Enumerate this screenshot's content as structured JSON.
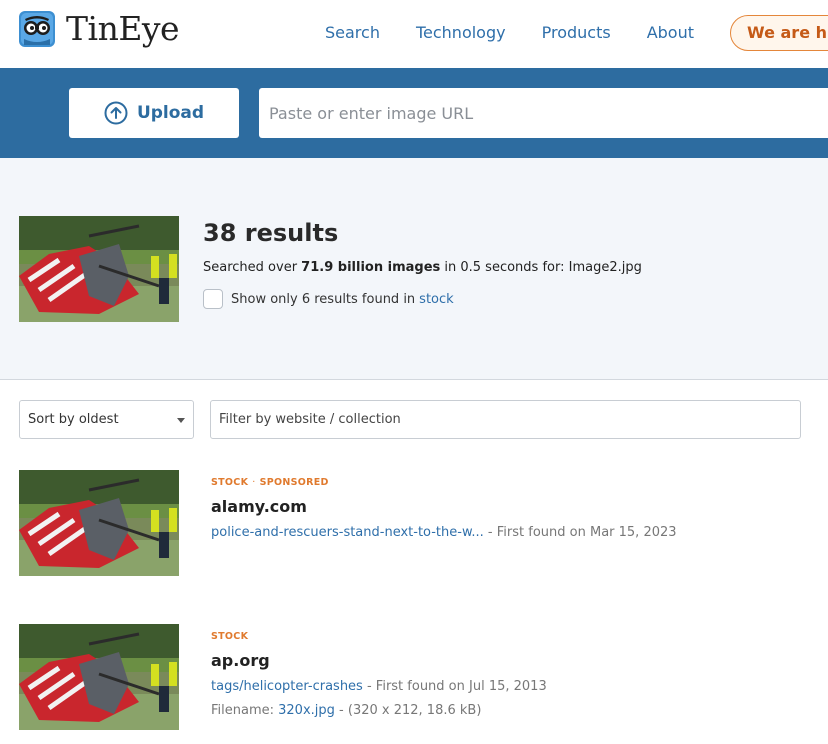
{
  "header": {
    "brand": "TinEye",
    "nav": [
      "Search",
      "Technology",
      "Products",
      "About"
    ],
    "hire_label": "We are hiring"
  },
  "search": {
    "upload_label": "Upload",
    "url_placeholder": "Paste or enter image URL"
  },
  "summary": {
    "count": "38 results",
    "searched_prefix": "Searched over ",
    "images_count": "71.9 billion images",
    "searched_mid": " in 0.5 seconds for: ",
    "filename": "Image2.jpg",
    "stock_text": "Show only 6 results found in ",
    "stock_link": "stock"
  },
  "filters": {
    "sort_value": "Sort by oldest",
    "filter_placeholder": "Filter by website / collection"
  },
  "results": [
    {
      "tag1": "STOCK",
      "tag_sep": "·",
      "tag2": "SPONSORED",
      "domain": "alamy.com",
      "link": "police-and-rescuers-stand-next-to-the-w...",
      "found": "First found on Mar 15, 2023"
    },
    {
      "tag1": "STOCK",
      "domain": "ap.org",
      "link": "tags/helicopter-crashes",
      "found": "First found on Jul 15, 2013",
      "filename_label": "Filename: ",
      "filename": "320x.jpg",
      "file_info": "(320 x 212, 18.6 kB)"
    }
  ],
  "colors": {
    "accent": "#2d6ca0",
    "link": "#2f6faa",
    "tag": "#e07a2e",
    "hire_border": "#e4863a"
  },
  "icons": [
    "tineye-robot-icon",
    "upload-arrow-icon",
    "chevron-down-icon"
  ]
}
